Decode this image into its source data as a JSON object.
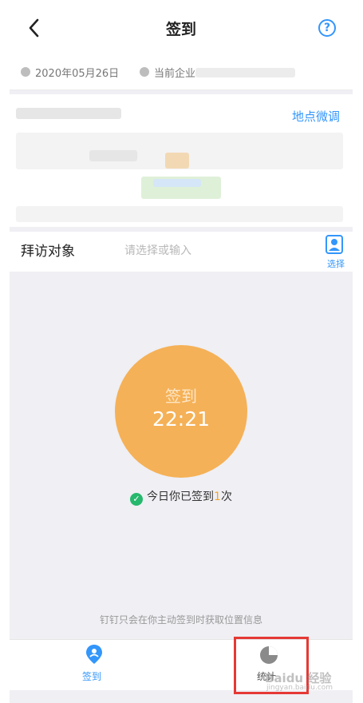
{
  "header": {
    "title": "签到",
    "help_symbol": "?"
  },
  "info": {
    "date": "2020年05月26日",
    "company_label": "当前企业"
  },
  "location": {
    "adjust_label": "地点微调"
  },
  "visit": {
    "label": "拜访对象",
    "placeholder": "请选择或输入",
    "select_label": "选择"
  },
  "checkin": {
    "label": "签到",
    "time": "22:21"
  },
  "status": {
    "prefix": "今日你已签到",
    "count": "1",
    "suffix": "次"
  },
  "privacy_note": "钉钉只会在你主动签到时获取位置信息",
  "tabs": [
    {
      "label": "签到",
      "active": true
    },
    {
      "label": "统计",
      "active": false
    }
  ],
  "watermark": {
    "text": "Baidu 经验",
    "url": "jingyan.baidu.com"
  },
  "colors": {
    "accent": "#3396fb",
    "checkin": "#f5b157",
    "success": "#26b86d",
    "highlight": "#e53935"
  }
}
